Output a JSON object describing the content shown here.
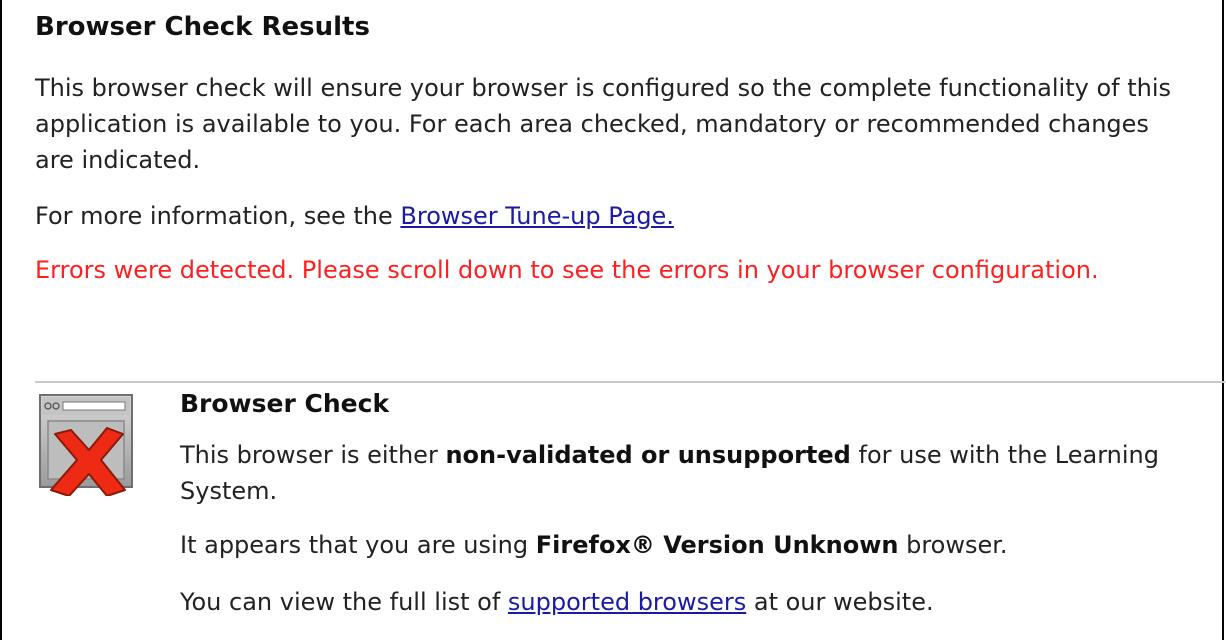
{
  "header": {
    "title": "Browser Check Results"
  },
  "intro": {
    "text": "This browser check will ensure your browser is configured so the complete functionality of this application is available to you. For each area checked, mandatory or recommended changes are indicated."
  },
  "more_info": {
    "prefix": "For more information, see the ",
    "link_text": "Browser Tune-up Page."
  },
  "errors": {
    "text": "Errors were detected. Please scroll down to see the errors in your browser configuration.",
    "color": "#ff1f1f"
  },
  "browser_check": {
    "icon": "browser-window-error-icon",
    "title": "Browser Check",
    "line1_prefix": "This browser is either ",
    "line1_bold": "non-validated or unsupported",
    "line1_suffix": " for use with the Learning System.",
    "line2_prefix": "It appears that you are using ",
    "line2_bold": "Firefox® Version Unknown",
    "line2_suffix": " browser.",
    "line3_prefix": "You can view the full list of ",
    "line3_link": "supported browsers",
    "line3_suffix": " at our website."
  },
  "colors": {
    "link": "#1a1aa6",
    "error": "#ff1f1f",
    "divider": "#c9c9c9"
  }
}
